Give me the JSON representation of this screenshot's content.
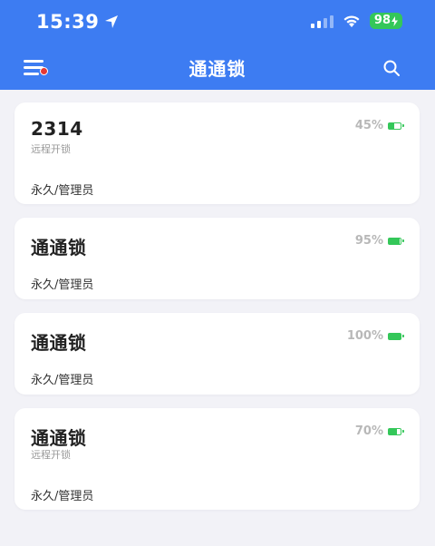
{
  "status_bar": {
    "time": "15:39",
    "battery": "98",
    "icons": [
      "location-arrow-icon",
      "cellular-signal-icon",
      "wifi-icon",
      "battery-icon"
    ]
  },
  "nav": {
    "title": "通通锁",
    "menu_icon": "hamburger-menu-icon",
    "search_icon": "search-icon"
  },
  "locks": [
    {
      "name": "2314",
      "subtitle": "远程开锁",
      "role": "永久/管理员",
      "battery_pct": "45%",
      "battery_level": 0.45
    },
    {
      "name": "通通锁",
      "subtitle": "",
      "role": "永久/管理员",
      "battery_pct": "95%",
      "battery_level": 0.95
    },
    {
      "name": "通通锁",
      "subtitle": "",
      "role": "永久/管理员",
      "battery_pct": "100%",
      "battery_level": 1.0
    },
    {
      "name": "通通锁",
      "subtitle": "远程开锁",
      "role": "永久/管理员",
      "battery_pct": "70%",
      "battery_level": 0.7
    }
  ],
  "colors": {
    "header": "#3d7cf2",
    "background": "#f2f2f7",
    "battery_green": "#34c759",
    "notification_dot": "#e53935"
  }
}
